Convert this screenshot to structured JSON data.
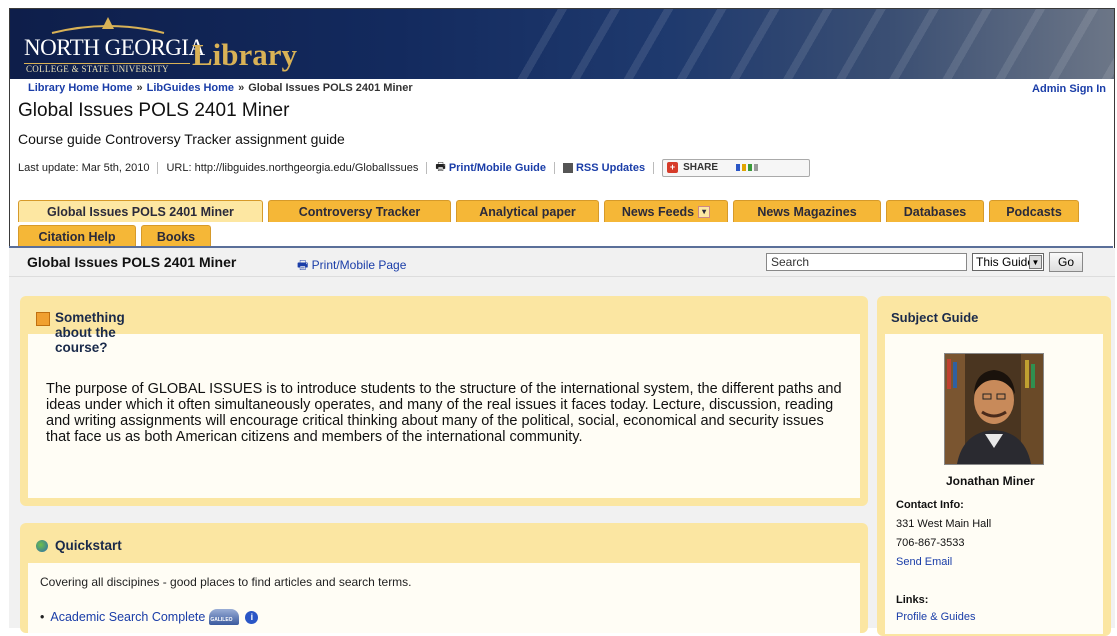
{
  "banner": {
    "logo_name": "NORTH GEORGIA",
    "logo_sub": "COLLEGE & STATE UNIVERSITY",
    "library_word": "Library"
  },
  "breadcrumb": {
    "home": "Library Home Home",
    "libguides": "LibGuides Home",
    "current": "Global Issues POLS 2401 Miner",
    "sep": "»"
  },
  "admin_link": "Admin Sign In",
  "guide": {
    "title": "Global Issues POLS 2401 Miner",
    "description": "Course guide Controversy Tracker assignment guide",
    "last_update": "Last update: Mar 5th, 2010",
    "url": "URL: http://libguides.northgeorgia.edu/GlobalIssues",
    "print_guide": "Print/Mobile Guide",
    "rss": "RSS Updates",
    "share": "SHARE"
  },
  "tabs": [
    {
      "label": "Global Issues POLS 2401 Miner",
      "active": true
    },
    {
      "label": "Controversy Tracker",
      "active": false
    },
    {
      "label": "Analytical paper",
      "active": false
    },
    {
      "label": "News Feeds",
      "active": false
    },
    {
      "label": "News Magazines",
      "active": false
    },
    {
      "label": "Databases",
      "active": false
    },
    {
      "label": "Podcasts",
      "active": false
    },
    {
      "label": "Citation Help",
      "active": false
    },
    {
      "label": "Books",
      "active": false
    }
  ],
  "subbar": {
    "title": "Global Issues POLS 2401 Miner",
    "print_page": "Print/Mobile Page",
    "search_placeholder": "Search",
    "scope": "This Guide",
    "go": "Go"
  },
  "boxes": {
    "course": {
      "heading": "Something about the course?",
      "text": "The purpose of GLOBAL ISSUES is to introduce students to the structure of the international system, the different paths and ideas under which it often simultaneously operates, and many of the real issues it faces today.  Lecture, discussion, reading and writing assignments will encourage critical thinking about many of the political, social, economical and security issues that face us as both American citizens and members of the international community."
    },
    "quickstart": {
      "heading": "Quickstart",
      "intro": "Covering all discipines - good places to find articles and search terms.",
      "link": "Academic Search Complete",
      "badge": "GALILEO"
    }
  },
  "sidebar": {
    "heading": "Subject Guide",
    "name": "Jonathan Miner",
    "contact_label": "Contact Info:",
    "address": "331 West Main Hall",
    "phone": "706-867-3533",
    "email_link": "Send Email",
    "links_label": "Links:",
    "profile_link": "Profile & Guides"
  },
  "colors": {
    "tab": "#f5b737",
    "tab_active": "#fde7a2",
    "box": "#fbe6a2",
    "link": "#1a3da8"
  }
}
